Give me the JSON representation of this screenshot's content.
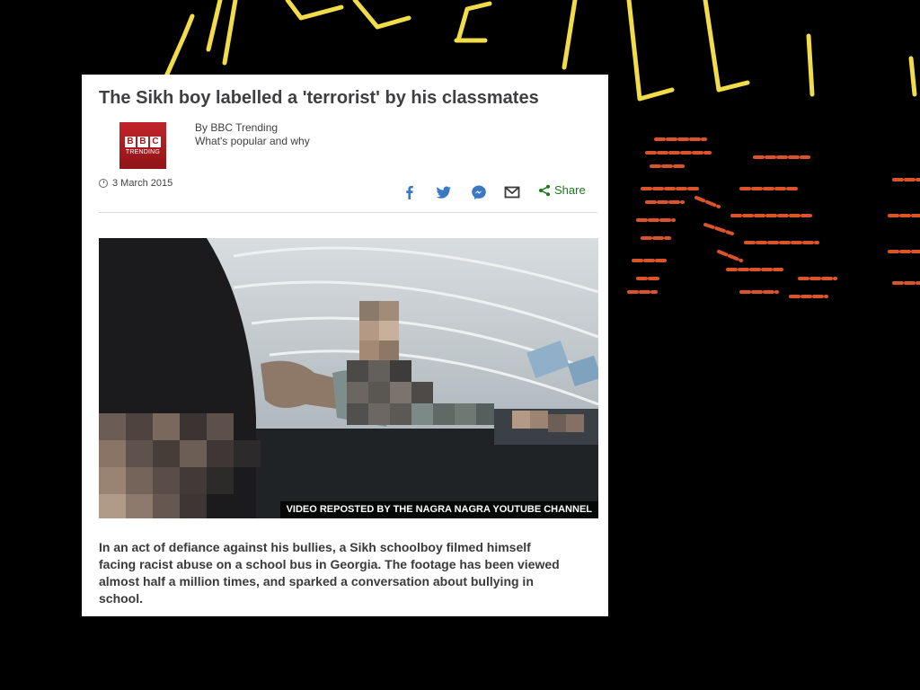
{
  "article": {
    "headline": "The Sikh boy labelled a 'terrorist' by his classmates",
    "logo": {
      "box_letters": [
        "B",
        "B",
        "C"
      ],
      "subtext": "TRENDING"
    },
    "byline": {
      "author": "By BBC Trending",
      "tagline": "What's popular and why"
    },
    "date": "3 March 2015",
    "share": {
      "icons": [
        "facebook-icon",
        "twitter-icon",
        "messenger-icon",
        "email-icon",
        "share-icon"
      ],
      "label": "Share"
    },
    "video": {
      "caption": "VIDEO REPOSTED BY THE NAGRA NAGRA YOUTUBE CHANNEL"
    },
    "summary": "In an act of defiance against his bullies, a Sikh schoolboy filmed himself facing racist abuse on a school bus in Georgia. The footage has been viewed almost half a million times, and sparked a conversation about bullying in school."
  },
  "colors": {
    "background": "#000000",
    "card": "#ffffff",
    "bbc_red": "#b71c1c",
    "share_green": "#1a7a1a",
    "social_blue": "#3b78c4",
    "deco_yellow": "#f2dc4a",
    "deco_orange": "#d9542a"
  }
}
